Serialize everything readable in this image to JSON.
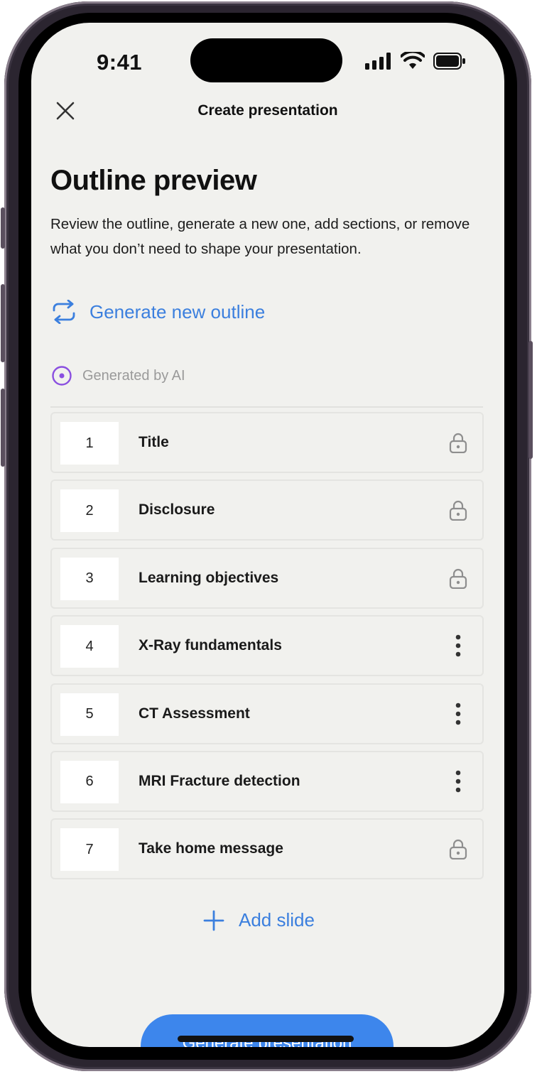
{
  "status_bar": {
    "time": "9:41",
    "icons": [
      "cellular-signal-icon",
      "wifi-icon",
      "battery-icon"
    ]
  },
  "header": {
    "title": "Create presentation",
    "close_icon": "close-icon"
  },
  "page": {
    "title": "Outline preview",
    "description": "Review the outline, generate a new one, add sections, or remove what you don’t need to shape your presentation."
  },
  "generate_link": {
    "label": "Generate new outline",
    "icon": "refresh-icon"
  },
  "ai_note": {
    "label": "Generated by AI",
    "icon": "ai-circle-icon"
  },
  "outline": [
    {
      "number": "1",
      "label": "Title",
      "action": "lock"
    },
    {
      "number": "2",
      "label": "Disclosure",
      "action": "lock"
    },
    {
      "number": "3",
      "label": "Learning objectives",
      "action": "lock"
    },
    {
      "number": "4",
      "label": "X-Ray fundamentals",
      "action": "more"
    },
    {
      "number": "5",
      "label": "CT Assessment",
      "action": "more"
    },
    {
      "number": "6",
      "label": "MRI Fracture detection",
      "action": "more"
    },
    {
      "number": "7",
      "label": "Take home message",
      "action": "lock"
    }
  ],
  "add_slide": {
    "label": "Add slide",
    "icon": "plus-icon"
  },
  "primary_button": {
    "label": "Generate presentation"
  },
  "colors": {
    "accent": "#3b7fde",
    "ai_purple": "#8a4fe0",
    "background": "#f1f1ee"
  }
}
